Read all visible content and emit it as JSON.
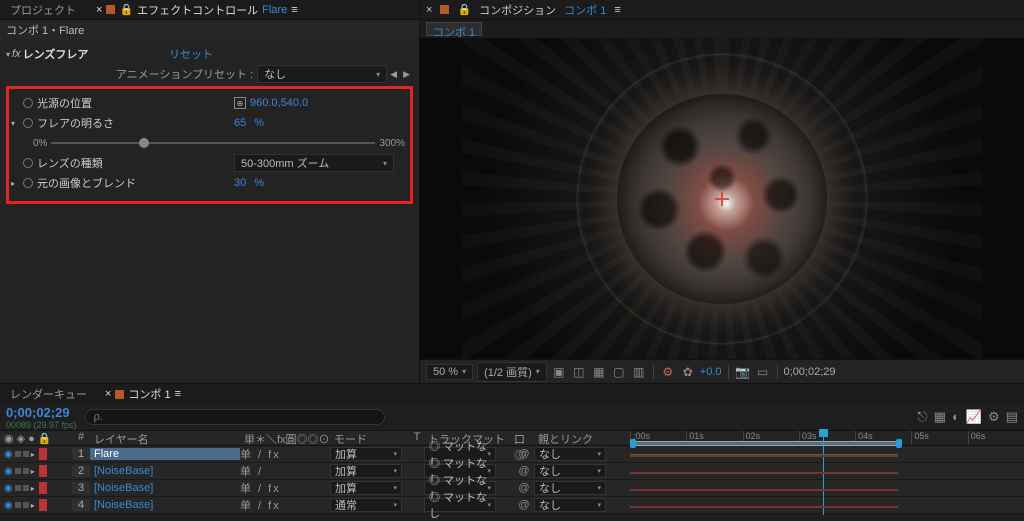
{
  "tabs": {
    "project": "プロジェクト",
    "effect_controls": "エフェクトコントロール",
    "effect_controls_target": "Flare",
    "composition": "コンポジション",
    "composition_target": "コンポ 1"
  },
  "crumb": "コンポ 1・Flare",
  "comp_chip": "コンポ 1",
  "effect": {
    "name": "レンズフレア",
    "reset": "リセット",
    "preset_label": "アニメーションプリセット :",
    "preset_value": "なし",
    "props": {
      "source_pos_label": "光源の位置",
      "source_pos_value": "960.0,540.0",
      "brightness_label": "フレアの明るさ",
      "brightness_value": "65",
      "brightness_unit": "%",
      "slider_min": "0%",
      "slider_max": "300%",
      "lens_type_label": "レンズの種類",
      "lens_type_value": "50-300mm ズーム",
      "blend_label": "元の画像とブレンド",
      "blend_value": "30",
      "blend_unit": "%"
    }
  },
  "viewer_toolbar": {
    "zoom": "50 %",
    "res": "(1/2 画質)",
    "exposure": "+0.0",
    "timecode": "0;00;02;29"
  },
  "timeline": {
    "tab_render": "レンダーキュー",
    "tab_comp": "コンポ 1",
    "timecode": "0;00;02;29",
    "subtime": "00089 (29.97 fps)",
    "search_placeholder": "ρ.",
    "headers": {
      "num": "#",
      "layer_name": "レイヤー名",
      "switches": "単＊＼fx圓◎◎⊙",
      "mode": "モード",
      "t": "T",
      "track_matte": "トラックマット",
      "parent": "親とリンク"
    },
    "ruler": [
      ":00s",
      "01s",
      "02s",
      "03s",
      "04s",
      "05s",
      "06s"
    ],
    "layers": [
      {
        "num": "1",
        "name": "Flare",
        "switches": "单     /  fx",
        "mode": "加算",
        "track": "マットなし",
        "parent": "なし",
        "selected": true
      },
      {
        "num": "2",
        "name": "[NoiseBase]",
        "switches": "单     /",
        "mode": "加算",
        "track": "マットなし",
        "parent": "なし",
        "selected": false
      },
      {
        "num": "3",
        "name": "[NoiseBase]",
        "switches": "单     /  fx",
        "mode": "加算",
        "track": "マットなし",
        "parent": "なし",
        "selected": false
      },
      {
        "num": "4",
        "name": "[NoiseBase]",
        "switches": "单     /  fx",
        "mode": "通常",
        "track": "マットなし",
        "parent": "なし",
        "selected": false
      }
    ]
  }
}
